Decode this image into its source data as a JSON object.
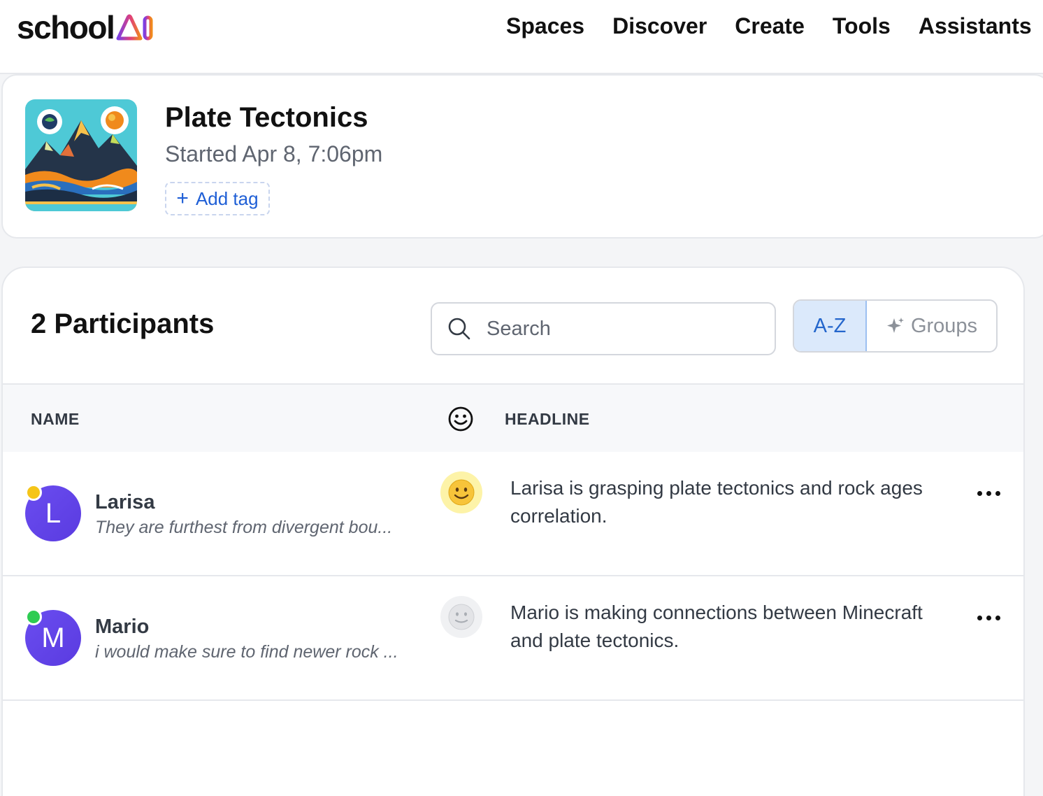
{
  "brand": {
    "logo_text": "school",
    "logo_ai": "AI"
  },
  "nav": {
    "items": [
      {
        "label": "Spaces"
      },
      {
        "label": "Discover"
      },
      {
        "label": "Create"
      },
      {
        "label": "Tools"
      },
      {
        "label": "Assistants"
      }
    ]
  },
  "space": {
    "title": "Plate Tectonics",
    "started": "Started Apr 8, 7:06pm",
    "add_tag_label": "Add tag"
  },
  "participants": {
    "title": "2 Participants",
    "search_placeholder": "Search",
    "sort_az_label": "A-Z",
    "groups_label": "Groups",
    "columns": {
      "name": "NAME",
      "headline": "HEADLINE"
    },
    "rows": [
      {
        "initial": "L",
        "name": "Larisa",
        "quote": "They are furthest from divergent bou...",
        "headline": "Larisa is grasping plate tectonics and rock ages correlation.",
        "status_color": "#f5c518",
        "mood": "happy",
        "mood_bg": "#fdf3a8"
      },
      {
        "initial": "M",
        "name": "Mario",
        "quote": "i would make sure to find newer rock ...",
        "headline": "Mario is making connections between Minecraft and plate tectonics.",
        "status_color": "#2ecc52",
        "mood": "neutral",
        "mood_bg": "#f0f1f3"
      }
    ]
  },
  "colors": {
    "accent": "#1f5fd6",
    "avatar": "#5a3be0"
  }
}
